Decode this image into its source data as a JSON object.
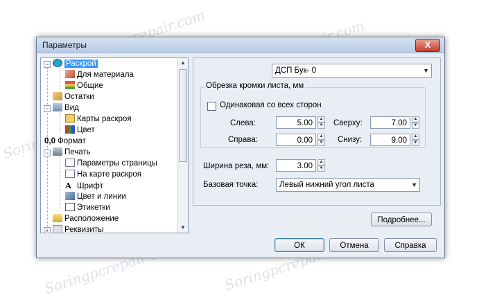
{
  "window": {
    "title": "Параметры",
    "close_label": "X"
  },
  "watermark": "Soringpcrepair.com",
  "tree": {
    "items": [
      {
        "label": "Раскрой",
        "icon": "gear-icon",
        "expander": "−"
      },
      {
        "label": "Для материала",
        "icon": "material-icon"
      },
      {
        "label": "Общие",
        "icon": "layers-icon"
      },
      {
        "label": "Остатки",
        "icon": "remnants-icon"
      },
      {
        "label": "Вид",
        "icon": "view-icon",
        "expander": "−"
      },
      {
        "label": "Карты раскроя",
        "icon": "cut-map-icon"
      },
      {
        "label": "Цвет",
        "icon": "color-icon"
      },
      {
        "label": "Формат",
        "icon": "format-icon",
        "prefix": "0,0"
      },
      {
        "label": "Печать",
        "icon": "printer-icon",
        "expander": "−"
      },
      {
        "label": "Параметры страницы",
        "icon": "page-icon"
      },
      {
        "label": "На карте раскроя",
        "icon": "map-page-icon"
      },
      {
        "label": "Шрифт",
        "icon": "font-icon",
        "glyph": "A"
      },
      {
        "label": "Цвет и линии",
        "icon": "paint-icon"
      },
      {
        "label": "Этикетки",
        "icon": "labels-icon"
      },
      {
        "label": "Расположение",
        "icon": "folder-icon"
      },
      {
        "label": "Реквизиты",
        "icon": "requisites-icon",
        "expander": "+"
      }
    ]
  },
  "material_select": {
    "value": "ДСП Бук- 0"
  },
  "trim_group": {
    "title": "Обрезка кромки листа, мм",
    "same_all_sides": "Одинаковая со всех сторон",
    "left": {
      "label": "Слева:",
      "value": "5.00"
    },
    "top": {
      "label": "Сверху:",
      "value": "7.00"
    },
    "right": {
      "label": "Справа:",
      "value": "0.00"
    },
    "bottom": {
      "label": "Снизу:",
      "value": "9.00"
    }
  },
  "cut_width": {
    "label": "Ширина реза, мм:",
    "value": "3.00"
  },
  "base_point": {
    "label": "Базовая точка:",
    "value": "Левый нижний угол листа"
  },
  "buttons": {
    "more": "Подробнее...",
    "ok": "ОК",
    "cancel": "Отмена",
    "help": "Справка"
  }
}
